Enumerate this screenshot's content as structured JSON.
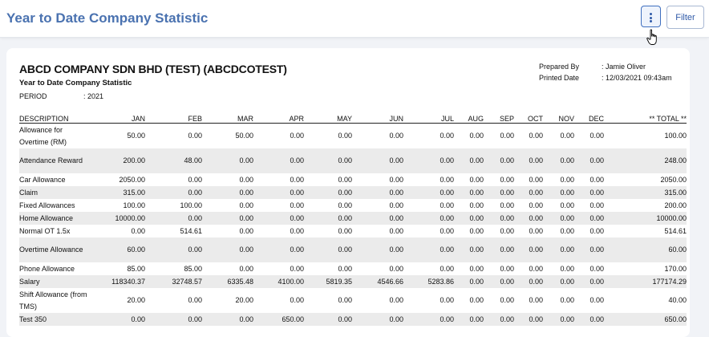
{
  "header": {
    "title": "Year to Date Company Statistic",
    "filter_label": "Filter"
  },
  "report": {
    "company": "ABCD COMPANY SDN BHD (TEST) (ABCDCOTEST)",
    "subtitle": "Year to Date Company Statistic",
    "period_label": "PERIOD",
    "period_value": ": 2021",
    "prepared_by_label": "Prepared By",
    "prepared_by_value": ": Jamie Oliver",
    "printed_date_label": "Printed Date",
    "printed_date_value": ": 12/03/2021 09:43am"
  },
  "table": {
    "columns": [
      "DESCRIPTION",
      "JAN",
      "FEB",
      "MAR",
      "APR",
      "MAY",
      "JUN",
      "JUL",
      "AUG",
      "SEP",
      "OCT",
      "NOV",
      "DEC",
      "** TOTAL **"
    ],
    "rows": [
      [
        "Allowance for Overtime (RM)",
        "50.00",
        "0.00",
        "50.00",
        "0.00",
        "0.00",
        "0.00",
        "0.00",
        "0.00",
        "0.00",
        "0.00",
        "0.00",
        "0.00",
        "100.00"
      ],
      [
        "Attendance Reward",
        "200.00",
        "48.00",
        "0.00",
        "0.00",
        "0.00",
        "0.00",
        "0.00",
        "0.00",
        "0.00",
        "0.00",
        "0.00",
        "0.00",
        "248.00"
      ],
      [
        "Car Allowance",
        "2050.00",
        "0.00",
        "0.00",
        "0.00",
        "0.00",
        "0.00",
        "0.00",
        "0.00",
        "0.00",
        "0.00",
        "0.00",
        "0.00",
        "2050.00"
      ],
      [
        "Claim",
        "315.00",
        "0.00",
        "0.00",
        "0.00",
        "0.00",
        "0.00",
        "0.00",
        "0.00",
        "0.00",
        "0.00",
        "0.00",
        "0.00",
        "315.00"
      ],
      [
        "Fixed Allowances",
        "100.00",
        "100.00",
        "0.00",
        "0.00",
        "0.00",
        "0.00",
        "0.00",
        "0.00",
        "0.00",
        "0.00",
        "0.00",
        "0.00",
        "200.00"
      ],
      [
        "Home Allowance",
        "10000.00",
        "0.00",
        "0.00",
        "0.00",
        "0.00",
        "0.00",
        "0.00",
        "0.00",
        "0.00",
        "0.00",
        "0.00",
        "0.00",
        "10000.00"
      ],
      [
        "Normal OT 1.5x",
        "0.00",
        "514.61",
        "0.00",
        "0.00",
        "0.00",
        "0.00",
        "0.00",
        "0.00",
        "0.00",
        "0.00",
        "0.00",
        "0.00",
        "514.61"
      ],
      [
        "Overtime Allowance",
        "60.00",
        "0.00",
        "0.00",
        "0.00",
        "0.00",
        "0.00",
        "0.00",
        "0.00",
        "0.00",
        "0.00",
        "0.00",
        "0.00",
        "60.00"
      ],
      [
        "Phone Allowance",
        "85.00",
        "85.00",
        "0.00",
        "0.00",
        "0.00",
        "0.00",
        "0.00",
        "0.00",
        "0.00",
        "0.00",
        "0.00",
        "0.00",
        "170.00"
      ],
      [
        "Salary",
        "118340.37",
        "32748.57",
        "6335.48",
        "4100.00",
        "5819.35",
        "4546.66",
        "5283.86",
        "0.00",
        "0.00",
        "0.00",
        "0.00",
        "0.00",
        "177174.29"
      ],
      [
        "Shift Allowance (from TMS)",
        "20.00",
        "0.00",
        "20.00",
        "0.00",
        "0.00",
        "0.00",
        "0.00",
        "0.00",
        "0.00",
        "0.00",
        "0.00",
        "0.00",
        "40.00"
      ],
      [
        "Test 350",
        "0.00",
        "0.00",
        "0.00",
        "650.00",
        "0.00",
        "0.00",
        "0.00",
        "0.00",
        "0.00",
        "0.00",
        "0.00",
        "0.00",
        "650.00"
      ]
    ]
  }
}
